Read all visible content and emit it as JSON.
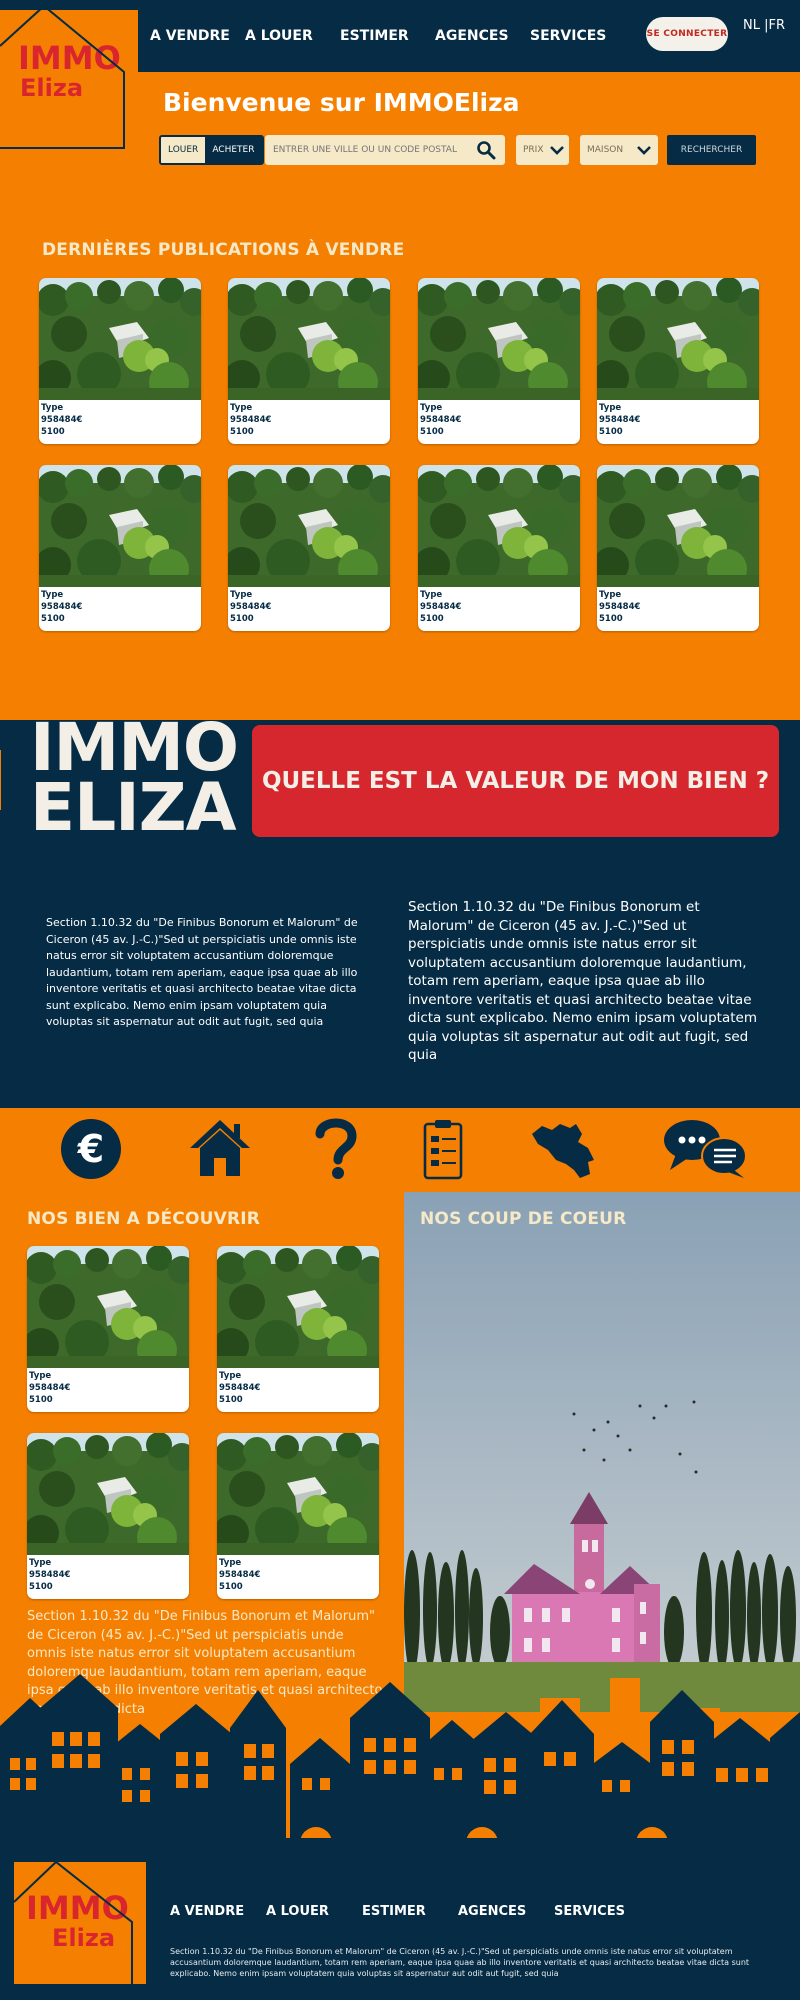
{
  "header": {
    "logo_line1": "IMMO",
    "logo_line2": "Eliza",
    "nav": [
      "A VENDRE",
      "A LOUER",
      "ESTIMER",
      "AGENCES",
      "SERVICES"
    ],
    "login_label": "SE CONNECTER",
    "lang_label": "NL  |FR",
    "welcome": "Bienvenue sur IMMOEliza"
  },
  "search": {
    "toggle_louer": "LOUER",
    "toggle_acheter": "ACHETER",
    "placeholder": "ENTRER UNE VILLE OU UN CODE POSTAL",
    "price_label": "PRIX",
    "type_label": "MAISON",
    "submit_label": "RECHERCHER"
  },
  "latest": {
    "title": "DERNIÈRES PUBLICATIONS À VENDRE",
    "cards": [
      {
        "type": "Type",
        "price": "958484€",
        "zip": "5100"
      },
      {
        "type": "Type",
        "price": "958484€",
        "zip": "5100"
      },
      {
        "type": "Type",
        "price": "958484€",
        "zip": "5100"
      },
      {
        "type": "Type",
        "price": "958484€",
        "zip": "5100"
      },
      {
        "type": "Type",
        "price": "958484€",
        "zip": "5100"
      },
      {
        "type": "Type",
        "price": "958484€",
        "zip": "5100"
      },
      {
        "type": "Type",
        "price": "958484€",
        "zip": "5100"
      },
      {
        "type": "Type",
        "price": "958484€",
        "zip": "5100"
      }
    ]
  },
  "brand": {
    "big_line1": "IMMO",
    "big_line2": "ELIZA",
    "value_button": "QUELLE EST LA VALEUR DE MON BIEN ?",
    "para_left": "Section 1.10.32 du \"De Finibus Bonorum et Malorum\" de Ciceron (45 av. J.-C.)\"Sed ut perspiciatis unde omnis iste natus error sit voluptatem accusantium doloremque laudantium, totam rem aperiam, eaque ipsa quae ab illo inventore veritatis et quasi architecto beatae vitae dicta sunt explicabo. Nemo enim ipsam voluptatem quia voluptas sit aspernatur aut odit aut fugit, sed quia",
    "para_right": "Section 1.10.32 du \"De Finibus Bonorum et Malorum\" de Ciceron (45 av. J.-C.)\"Sed ut perspiciatis unde omnis iste natus error sit voluptatem accusantium doloremque laudantium, totam rem aperiam, eaque ipsa quae ab illo inventore veritatis et quasi architecto beatae vitae dicta sunt explicabo. Nemo enim ipsam voluptatem quia voluptas sit aspernatur aut odit aut fugit, sed quia"
  },
  "icons": [
    "euro-icon",
    "house-icon",
    "question-icon",
    "clipboard-icon",
    "belgium-map-icon",
    "chat-icon"
  ],
  "discover": {
    "title": "NOS BIEN A DÉCOUVRIR",
    "cards": [
      {
        "type": "Type",
        "price": "958484€",
        "zip": "5100"
      },
      {
        "type": "Type",
        "price": "958484€",
        "zip": "5100"
      },
      {
        "type": "Type",
        "price": "958484€",
        "zip": "5100"
      },
      {
        "type": "Type",
        "price": "958484€",
        "zip": "5100"
      }
    ],
    "para": "Section 1.10.32 du \"De Finibus Bonorum et Malorum\" de Ciceron (45 av. J.-C.)\"Sed ut perspiciatis unde omnis iste natus error sit voluptatem accusantium doloremque laudantium, totam rem aperiam, eaque ipsa quae ab illo inventore veritatis et quasi architecto beatae vitae dicta"
  },
  "coeur": {
    "title": "NOS COUP DE COEUR"
  },
  "footer": {
    "logo_line1": "IMMO",
    "logo_line2": "Eliza",
    "nav": [
      "A VENDRE",
      "A LOUER",
      "ESTIMER",
      "AGENCES",
      "SERVICES"
    ],
    "text": "Section 1.10.32 du \"De Finibus Bonorum et Malorum\" de Ciceron (45 av. J.-C.)\"Sed ut perspiciatis unde omnis iste natus error sit voluptatem accusantium doloremque laudantium, totam rem aperiam, eaque ipsa quae ab illo inventore veritatis et quasi architecto beatae vitae dicta sunt explicabo. Nemo enim ipsam voluptatem quia voluptas sit aspernatur aut odit aut fugit, sed quia"
  },
  "colors": {
    "orange": "#f57f00",
    "navy": "#062b44",
    "red": "#d6272e",
    "cream": "#f6e9c8"
  }
}
